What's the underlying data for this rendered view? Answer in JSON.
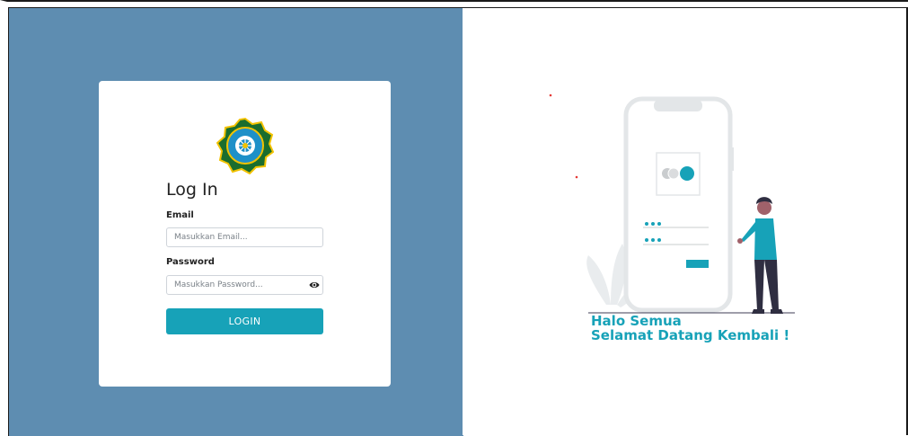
{
  "login": {
    "title": "Log In",
    "email_label": "Email",
    "email_placeholder": "Masukkan Email...",
    "password_label": "Password",
    "password_placeholder": "Masukkan Password...",
    "login_button": "LOGIN",
    "show_password_icon": "eye-icon"
  },
  "greeting": {
    "line1": "Halo Semua",
    "line2": "Selamat Datang Kembali !"
  },
  "colors": {
    "left_background": "#5e8db1",
    "accent": "#17a2b8",
    "card": "#ffffff"
  }
}
